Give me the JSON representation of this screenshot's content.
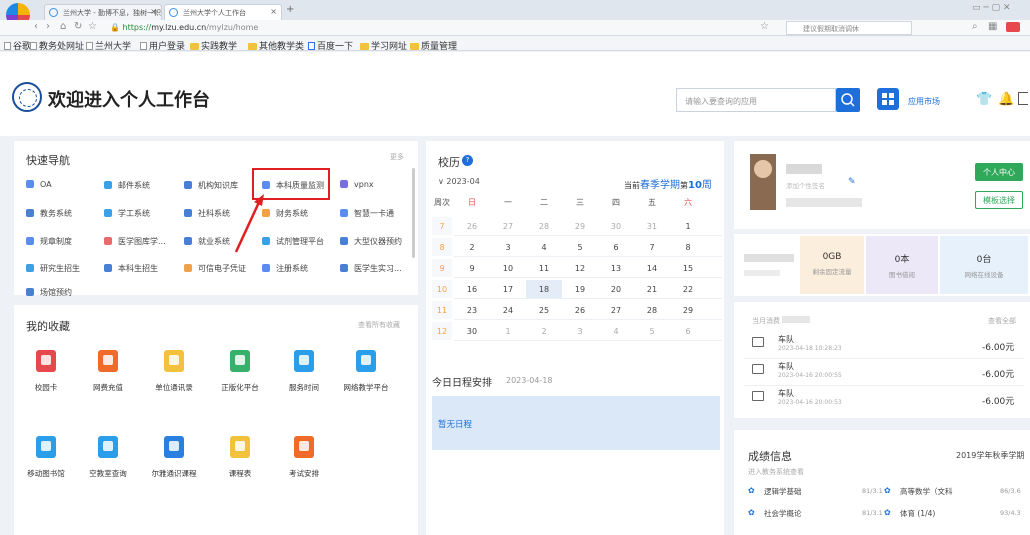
{
  "browser": {
    "tabs": [
      {
        "label": "兰州大学 - 勤博不息，独树一帜"
      },
      {
        "label": "兰州大学个人工作台"
      }
    ],
    "new_tab": "+",
    "url_prefix": "https://",
    "url_host": "my.lzu.edu.cn",
    "url_path": "/mylzu/home",
    "search_placeholder": "建议假期取消调休",
    "bookmarks": [
      "谷歌",
      "教务处网址",
      "兰州大学",
      "用户登录",
      "实践教学",
      "其他教学类",
      "百度一下",
      "学习网址",
      "质量管理"
    ]
  },
  "header": {
    "title": "欢迎进入个人工作台",
    "search_placeholder": "请输入要查询的应用",
    "app_market": "应用市场"
  },
  "quick_nav": {
    "title": "快速导航",
    "more": "更多",
    "items": [
      {
        "label": "OA",
        "color": "#5b8def"
      },
      {
        "label": "邮件系统",
        "color": "#3aa0e8"
      },
      {
        "label": "机构知识库",
        "color": "#4a7fd6"
      },
      {
        "label": "本科质量监测",
        "color": "#5b8def"
      },
      {
        "label": "vpnx",
        "color": "#7b6fe0"
      },
      {
        "label": "教务系统",
        "color": "#4a7fd6"
      },
      {
        "label": "学工系统",
        "color": "#3aa0e8"
      },
      {
        "label": "社科系统",
        "color": "#4a7fd6"
      },
      {
        "label": "财务系统",
        "color": "#f0a24a"
      },
      {
        "label": "智慧一卡通",
        "color": "#5b8def"
      },
      {
        "label": "规章制度",
        "color": "#5b8def"
      },
      {
        "label": "医学图库学...",
        "color": "#e86a6a"
      },
      {
        "label": "就业系统",
        "color": "#4a7fd6"
      },
      {
        "label": "试剂管理平台",
        "color": "#3aa0e8"
      },
      {
        "label": "大型仪器预约",
        "color": "#4a7fd6"
      },
      {
        "label": "研究生招生",
        "color": "#3aa0e8"
      },
      {
        "label": "本科生招生",
        "color": "#4a7fd6"
      },
      {
        "label": "可信电子凭证",
        "color": "#f0a24a"
      },
      {
        "label": "注册系统",
        "color": "#5b8def"
      },
      {
        "label": "医学生实习...",
        "color": "#4a7fd6"
      },
      {
        "label": "场馆预约",
        "color": "#4a7fd6"
      }
    ]
  },
  "favorites": {
    "title": "我的收藏",
    "more": "查看所有收藏",
    "items": [
      {
        "label": "校园卡",
        "color": "#e8474c"
      },
      {
        "label": "网费充值",
        "color": "#f06a2a"
      },
      {
        "label": "单位通讯录",
        "color": "#f3c23c"
      },
      {
        "label": "正版化平台",
        "color": "#36b06a"
      },
      {
        "label": "服务时间",
        "color": "#2a9ee8"
      },
      {
        "label": "网络教学平台",
        "color": "#2a9ee8"
      },
      {
        "label": "移动图书馆",
        "color": "#2a9ee8"
      },
      {
        "label": "空教室查询",
        "color": "#2a9ee8"
      },
      {
        "label": "尔雅通识课程",
        "color": "#2a7fe0"
      },
      {
        "label": "课程表",
        "color": "#f3c23c"
      },
      {
        "label": "考试安排",
        "color": "#f06a2a"
      }
    ]
  },
  "calendar": {
    "title": "校历",
    "month": "2023-04",
    "current_prefix": "当前",
    "term": "春季学期",
    "week_prefix": "第",
    "week_number": "10",
    "week_suffix": "周",
    "headers": [
      "周次",
      "日",
      "一",
      "二",
      "三",
      "四",
      "五",
      "六"
    ],
    "rows": [
      {
        "week": "7",
        "days": [
          "26",
          "27",
          "28",
          "29",
          "30",
          "31",
          "1"
        ]
      },
      {
        "week": "8",
        "days": [
          "2",
          "3",
          "4",
          "5",
          "6",
          "7",
          "8"
        ]
      },
      {
        "week": "9",
        "days": [
          "9",
          "10",
          "11",
          "12",
          "13",
          "14",
          "15"
        ]
      },
      {
        "week": "10",
        "days": [
          "16",
          "17",
          "18",
          "19",
          "20",
          "21",
          "22"
        ]
      },
      {
        "week": "11",
        "days": [
          "23",
          "24",
          "25",
          "26",
          "27",
          "28",
          "29"
        ]
      },
      {
        "week": "12",
        "days": [
          "30",
          "1",
          "2",
          "3",
          "4",
          "5",
          "6"
        ]
      }
    ],
    "today": "18"
  },
  "schedule": {
    "title": "今日日程安排",
    "date": "2023-04-18",
    "empty": "暂无日程"
  },
  "profile": {
    "personal_center": "个人中心",
    "template_select": "模板选择",
    "signature_placeholder": "添加个性签名"
  },
  "stats": [
    {
      "value": "0GB",
      "label": "剩余固定流量",
      "color": "#fbeedd"
    },
    {
      "value": "0本",
      "label": "图书借阅",
      "color": "#ece8f8"
    },
    {
      "value": "0台",
      "label": "网络在线设备",
      "color": "#e7f1fb"
    }
  ],
  "consumption": {
    "title": "当月消费",
    "more": "查看全部",
    "items": [
      {
        "name": "车队",
        "time": "2023-04-18 10:28:23",
        "amount": "-6.00元"
      },
      {
        "name": "车队",
        "time": "2023-04-16 20:00:55",
        "amount": "-6.00元"
      },
      {
        "name": "车队",
        "time": "2023-04-16 20:00:53",
        "amount": "-6.00元"
      }
    ]
  },
  "grades": {
    "title": "成绩信息",
    "term": "2019学年秋季学期",
    "subtitle": "进入教务系统查看",
    "items": [
      {
        "course": "逻辑学基础",
        "score": "81/3.1"
      },
      {
        "course": "高等数学（文科",
        "score": "86/3.6"
      },
      {
        "course": "社会学概论",
        "score": "81/3.1"
      },
      {
        "course": "体育 (1/4)",
        "score": "93/4.3"
      }
    ]
  },
  "colors": {
    "accent": "#1e6fd9",
    "highlight": "#e02020",
    "calendar_bar": "#f0a24a"
  }
}
